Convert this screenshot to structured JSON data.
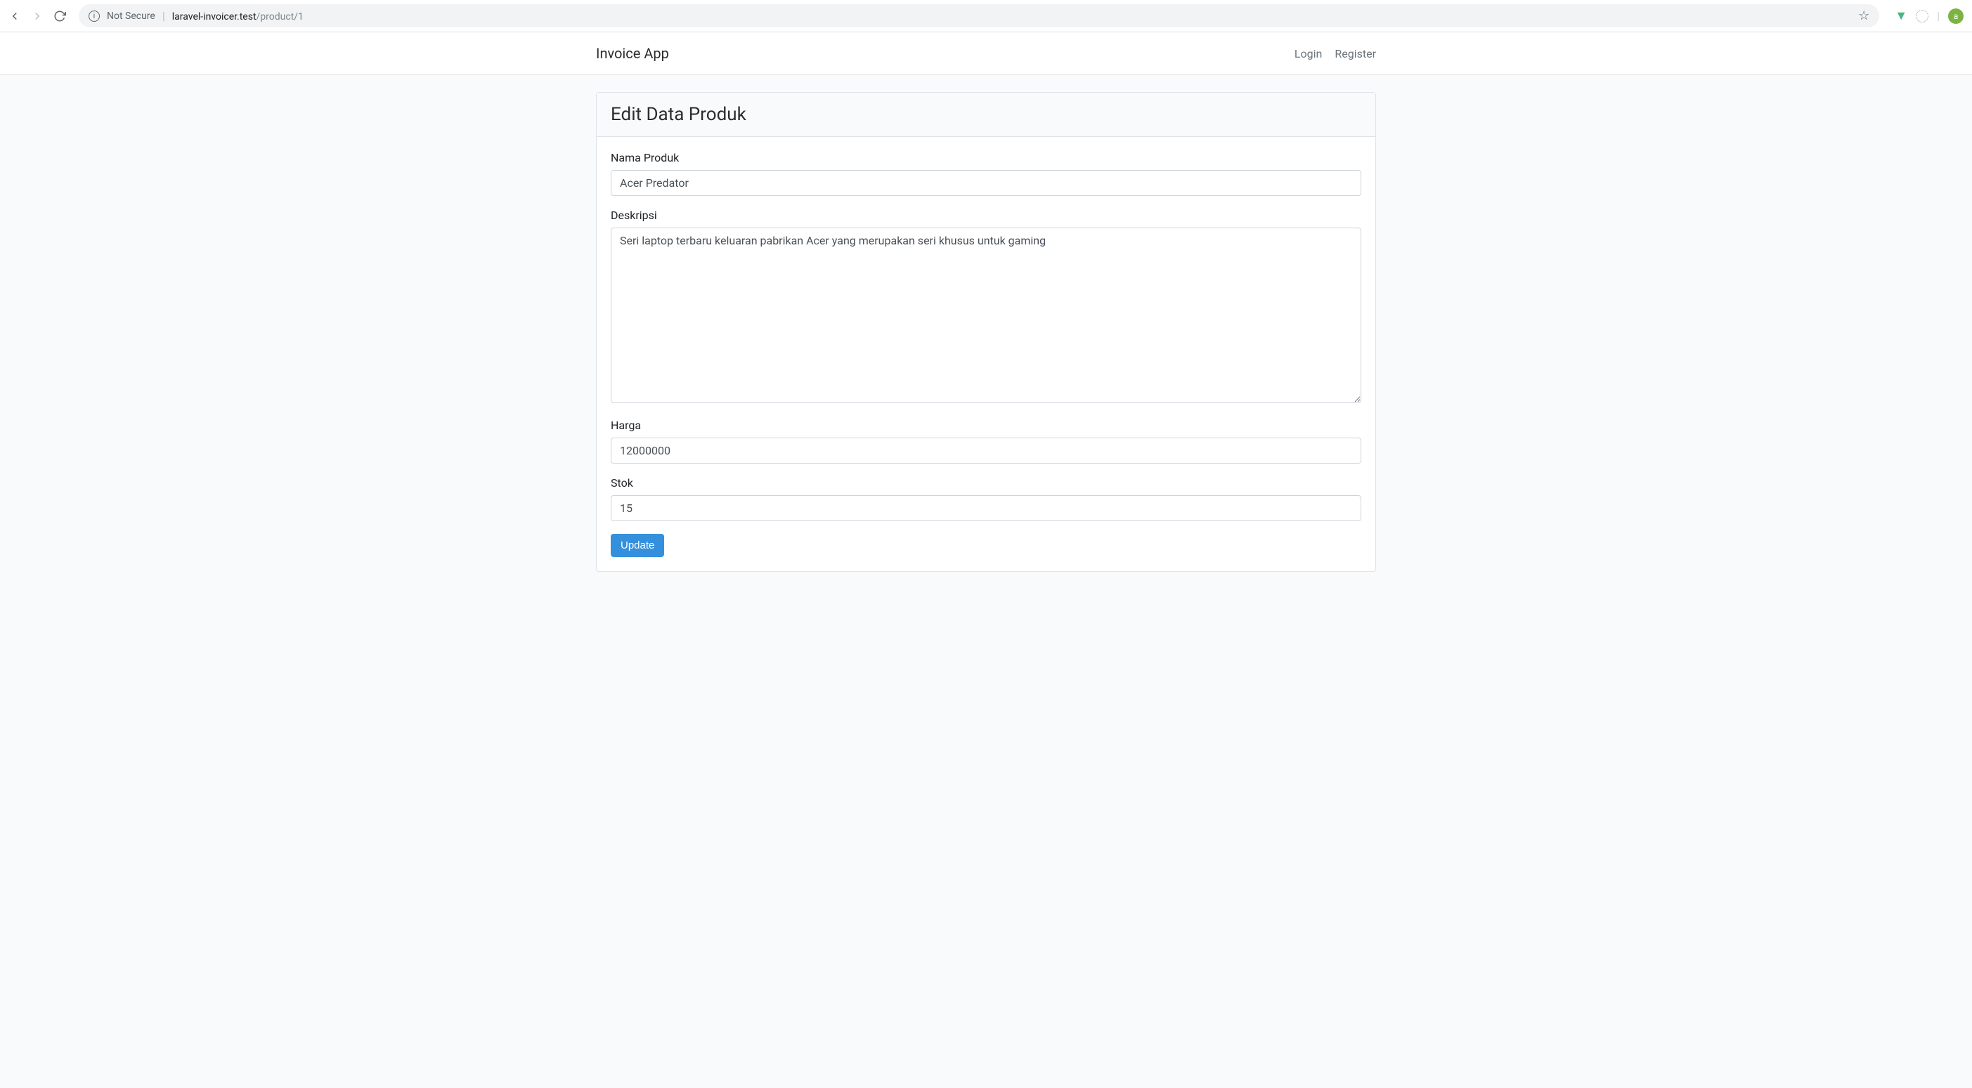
{
  "browser": {
    "not_secure": "Not Secure",
    "url_host": "laravel-invoicer.test",
    "url_path": "/product/1",
    "avatar_letter": "a"
  },
  "navbar": {
    "brand": "Invoice App",
    "login": "Login",
    "register": "Register"
  },
  "card": {
    "title": "Edit Data Produk"
  },
  "form": {
    "name_label": "Nama Produk",
    "name_value": "Acer Predator",
    "desc_label": "Deskripsi",
    "desc_value": "Seri laptop terbaru keluaran pabrikan Acer yang merupakan seri khusus untuk gaming",
    "price_label": "Harga",
    "price_value": "12000000",
    "stock_label": "Stok",
    "stock_value": "15",
    "submit_label": "Update"
  }
}
